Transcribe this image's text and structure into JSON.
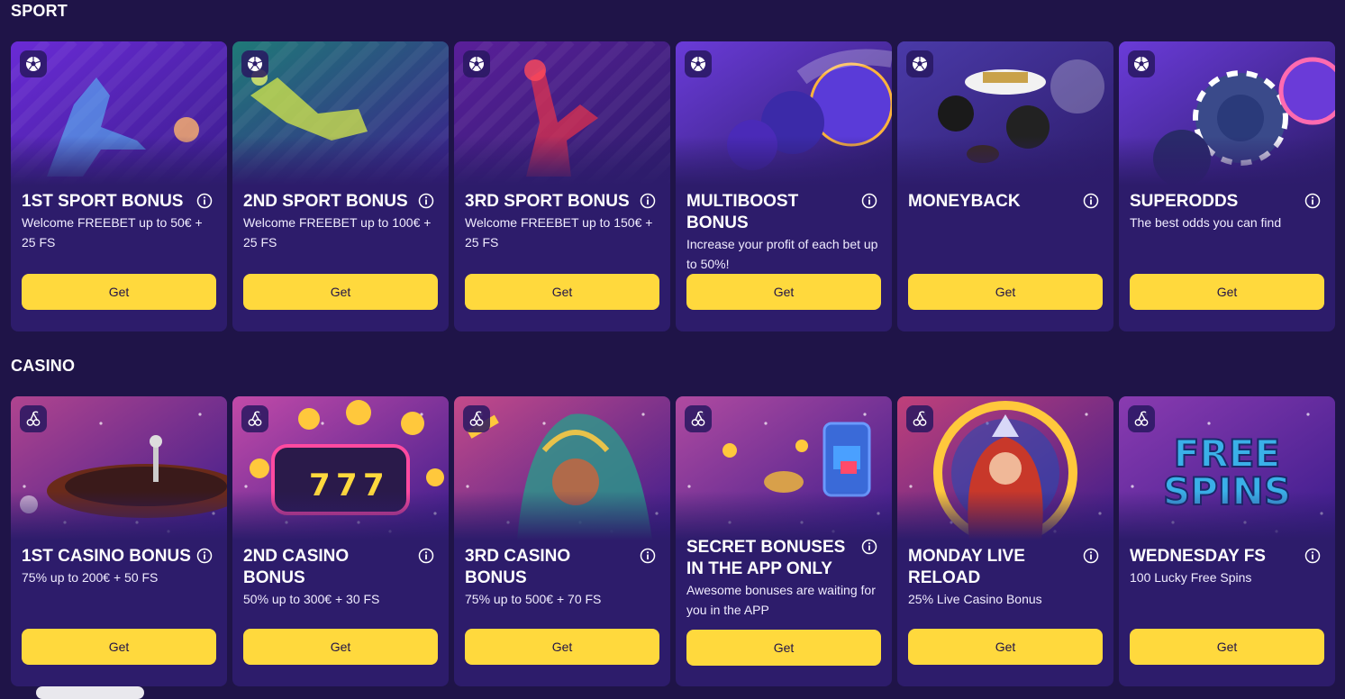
{
  "sections": [
    {
      "title": "SPORT",
      "category_icon": "soccer-ball-icon",
      "cards": [
        {
          "title": "1ST SPORT BONUS",
          "desc": "Welcome FREEBET up to 50€ + 25 FS",
          "button": "Get",
          "art": "sport-kick",
          "colors": [
            "#6a2bd6",
            "#3b1c8c"
          ]
        },
        {
          "title": "2ND SPORT BONUS",
          "desc": "Welcome FREEBET up to 100€ + 25 FS",
          "button": "Get",
          "art": "sport-dive",
          "colors": [
            "#1f7a78",
            "#3b1c8c"
          ]
        },
        {
          "title": "3RD SPORT BONUS",
          "desc": "Welcome FREEBET up to 150€ + 25 FS",
          "button": "Get",
          "art": "sport-throw",
          "colors": [
            "#5a1f9a",
            "#2d1c6b"
          ]
        },
        {
          "title": "MULTIBOOST BONUS",
          "desc": "Increase your profit of each bet up to 50%!",
          "button": "Get",
          "art": "sport-balls",
          "colors": [
            "#6a3bd8",
            "#2d1c6b"
          ]
        },
        {
          "title": "MONEYBACK",
          "desc": "",
          "button": "Get",
          "art": "sport-cash",
          "colors": [
            "#4a3aa8",
            "#2d1c6b"
          ]
        },
        {
          "title": "SUPERODDS",
          "desc": "The best odds you can find",
          "button": "Get",
          "art": "sport-chips",
          "colors": [
            "#6a3bd8",
            "#2d1c6b"
          ]
        }
      ]
    },
    {
      "title": "CASINO",
      "category_icon": "cherries-icon",
      "cards": [
        {
          "title": "1ST CASINO BONUS",
          "desc": "75% up to 200€ + 50 FS",
          "button": "Get",
          "art": "casino-roulette",
          "colors": [
            "#b0448f",
            "#3b1c8c"
          ]
        },
        {
          "title": "2ND CASINO BONUS",
          "desc": "50% up to 300€ + 30 FS",
          "button": "Get",
          "art": "casino-slot",
          "colors": [
            "#c24aa8",
            "#3b1c8c"
          ]
        },
        {
          "title": "3RD CASINO BONUS",
          "desc": "75% up to 500€ + 70 FS",
          "button": "Get",
          "art": "casino-carnival",
          "colors": [
            "#c44a8a",
            "#3b1c8c"
          ]
        },
        {
          "title": "SECRET BONUSES IN THE APP ONLY",
          "desc": "Awesome bonuses are waiting for you in the APP",
          "button": "Get",
          "art": "casino-phone",
          "colors": [
            "#b04aa0",
            "#3b1c8c"
          ]
        },
        {
          "title": "MONDAY LIVE RELOAD",
          "desc": "25% Live Casino Bonus",
          "button": "Get",
          "art": "casino-queen",
          "colors": [
            "#c0407a",
            "#3b1c8c"
          ]
        },
        {
          "title": "WEDNESDAY FS",
          "desc": "100 Lucky Free Spins",
          "button": "Get",
          "art": "casino-freespins",
          "art_text": [
            "FREE",
            "SPINS"
          ],
          "colors": [
            "#8a3bb0",
            "#3b1c8c"
          ]
        }
      ]
    }
  ]
}
